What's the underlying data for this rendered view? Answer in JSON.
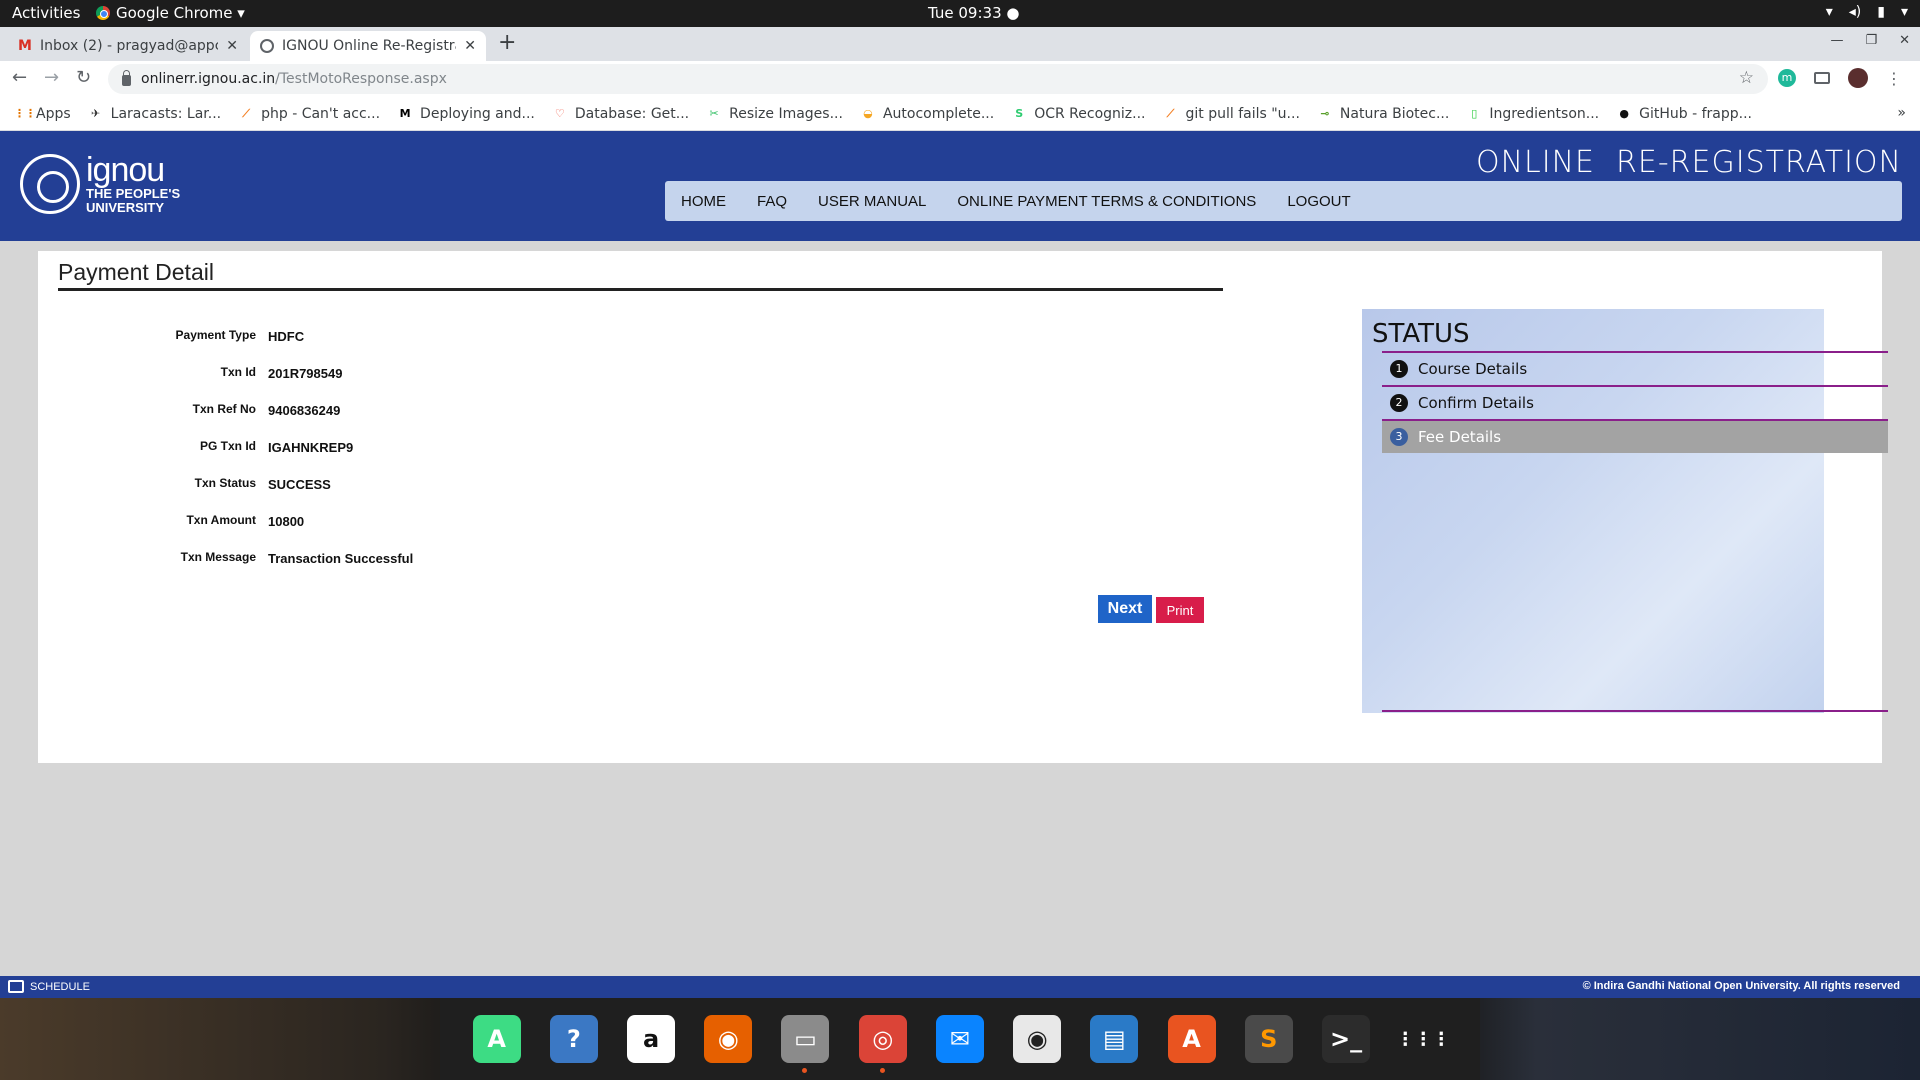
{
  "topbar": {
    "activities": "Activities",
    "app_name": "Google Chrome ▾",
    "clock": "Tue 09:33 ●",
    "sys_icons": [
      "wifi-icon",
      "volume-icon",
      "battery-icon",
      "power-icon"
    ]
  },
  "tabs": [
    {
      "title": "Inbox (2) - pragyad@appc",
      "icon": "gmail-icon"
    },
    {
      "title": "IGNOU Online Re-Registra",
      "icon": "globe-icon"
    }
  ],
  "addressbar": {
    "host": "onlinerr.ignou.ac.in",
    "path": "/TestMotoResponse.aspx"
  },
  "bookmarks": [
    {
      "label": "Apps",
      "icon": "⋮⋮",
      "color": "#e37400"
    },
    {
      "label": "Laracasts: Lar...",
      "icon": "✈",
      "color": "#333"
    },
    {
      "label": "php - Can't acc...",
      "icon": "⟋",
      "color": "#f48024"
    },
    {
      "label": "Deploying and...",
      "icon": "M",
      "color": "#000"
    },
    {
      "label": "Database: Get...",
      "icon": "♡",
      "color": "#f05340"
    },
    {
      "label": "Resize Images...",
      "icon": "✂",
      "color": "#2dbe60"
    },
    {
      "label": "Autocomplete...",
      "icon": "◒",
      "color": "#f5a623"
    },
    {
      "label": "OCR Recogniz...",
      "icon": "S",
      "color": "#2ecc71"
    },
    {
      "label": "git pull fails \"u...",
      "icon": "⟋",
      "color": "#f48024"
    },
    {
      "label": "Natura Biotec...",
      "icon": "⊸",
      "color": "#5aa02c"
    },
    {
      "label": "Ingredientson...",
      "icon": "▯",
      "color": "#2ecc40"
    },
    {
      "label": "GitHub - frapp...",
      "icon": "●",
      "color": "#111"
    }
  ],
  "bookmarks_more": "»",
  "site": {
    "logo_big": "ignou",
    "logo_small_1": "THE PEOPLE'S",
    "logo_small_2": "UNIVERSITY",
    "title": "ONLINE  RE-REGISTRATION",
    "nav": [
      "HOME",
      "FAQ",
      "USER MANUAL",
      "ONLINE PAYMENT TERMS & CONDITIONS",
      "LOGOUT"
    ]
  },
  "payment": {
    "title": "Payment Detail",
    "rows": [
      {
        "label": "Payment Type",
        "value": "HDFC"
      },
      {
        "label": "Txn Id",
        "value": "201R798549"
      },
      {
        "label": "Txn Ref No",
        "value": "9406836249"
      },
      {
        "label": "PG Txn Id",
        "value": "IGAHNKREP9"
      },
      {
        "label": "Txn Status",
        "value": "SUCCESS"
      },
      {
        "label": "Txn Amount",
        "value": "10800"
      },
      {
        "label": "Txn Message",
        "value": "Transaction Successful"
      }
    ],
    "next_label": "Next",
    "print_label": "Print"
  },
  "status": {
    "title": "STATUS",
    "items": [
      {
        "num": "1",
        "label": "Course Details",
        "active": false
      },
      {
        "num": "2",
        "label": "Confirm Details",
        "active": false
      },
      {
        "num": "3",
        "label": "Fee Details",
        "active": true
      }
    ]
  },
  "footer": {
    "schedule": "SCHEDULE",
    "copyright": "© Indira Gandhi National Open University. All rights reserved"
  },
  "dock": [
    {
      "name": "android-studio-icon",
      "glyph": "A",
      "bg": "#3ddc84",
      "running": false
    },
    {
      "name": "help-icon",
      "glyph": "?",
      "bg": "#3b78c4",
      "running": false
    },
    {
      "name": "amazon-icon",
      "glyph": "a",
      "bg": "#ffffff",
      "fg": "#111",
      "running": false
    },
    {
      "name": "firefox-icon",
      "glyph": "◉",
      "bg": "#e66000",
      "running": false
    },
    {
      "name": "files-icon",
      "glyph": "▭",
      "bg": "#8b8b8b",
      "running": true
    },
    {
      "name": "chrome-icon",
      "glyph": "◎",
      "bg": "#db4437",
      "running": true
    },
    {
      "name": "thunderbird-icon",
      "glyph": "✉",
      "bg": "#0a84ff",
      "running": false
    },
    {
      "name": "rhythmbox-icon",
      "glyph": "◉",
      "bg": "#e8e8e8",
      "fg": "#222",
      "running": false
    },
    {
      "name": "writer-icon",
      "glyph": "▤",
      "bg": "#2a7ac7",
      "running": false
    },
    {
      "name": "software-center-icon",
      "glyph": "A",
      "bg": "#e95420",
      "running": false
    },
    {
      "name": "sublime-text-icon",
      "glyph": "S",
      "bg": "#4a4a4a",
      "fg": "#ff9800",
      "running": false
    },
    {
      "name": "terminal-icon",
      "glyph": ">_",
      "bg": "#2c2c2c",
      "running": false
    },
    {
      "name": "app-grid-icon",
      "glyph": "⋮⋮⋮",
      "bg": "transparent",
      "running": false
    }
  ]
}
